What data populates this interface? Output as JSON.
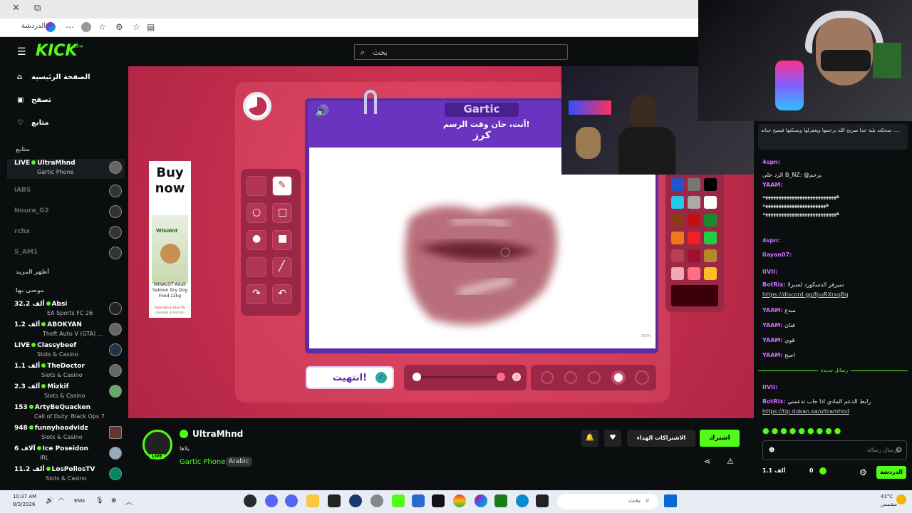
{
  "browser": {
    "sidebar_label": "الدردشة",
    "win_close": "✕",
    "win_restore": "⧉"
  },
  "kick": {
    "logo": "KICK",
    "logo_beta": "BETA",
    "search_placeholder": "بحث",
    "nav": [
      {
        "label": "الصفحة الرئيسية",
        "icon": "home-icon"
      },
      {
        "label": "تصفح",
        "icon": "browse-icon"
      },
      {
        "label": "متابع",
        "icon": "heart-icon"
      }
    ],
    "following_title": "متابع",
    "show_more": "أظهر المزيد",
    "recommended_title": "موصى بها",
    "following": [
      {
        "name": "UltraMhnd",
        "status": "LIVE",
        "game": "Gartic Phone",
        "live": true
      },
      {
        "name": "iABS",
        "live": false
      },
      {
        "name": "Noura_G2",
        "live": false
      },
      {
        "name": "rchx",
        "live": false
      },
      {
        "name": "S_AM1",
        "live": false
      }
    ],
    "recommended": [
      {
        "count": "32.2 ألف",
        "name": "Absi",
        "game": "EA Sports FC 26"
      },
      {
        "count": "1.2 ألف",
        "name": "ABOKYAN",
        "game": "Theft Auto V (GTA) ..."
      },
      {
        "count": "LIVE",
        "name": "Classybeef",
        "game": "Slots & Casino"
      },
      {
        "count": "1.1 ألف",
        "name": "TheDoctor",
        "game": "Slots & Casino"
      },
      {
        "count": "2.3 ألف",
        "name": "Mizkif",
        "game": "Slots & Casino"
      },
      {
        "count": "153",
        "name": "ArtyBeQuacken",
        "game": "Call of Duty: Black Ops 7"
      },
      {
        "count": "948",
        "name": "funnyhoodvidz",
        "game": "Slots & Casino"
      },
      {
        "count": "6 آلاف",
        "name": "Ice Poseidon",
        "game": "IRL"
      },
      {
        "count": "11.2 ألف",
        "name": "LosPollosTV",
        "game": "Slots & Casino"
      }
    ]
  },
  "game": {
    "brand": "Gartic",
    "prompt": "أنت، حان وقت الرسم!",
    "word": "كرز",
    "done_button": "انتهيت!",
    "zoom": "300%",
    "colors": [
      "#2255cc",
      "#777777",
      "#000000",
      "#22c8f0",
      "#aaaaaa",
      "#ffffff",
      "#8b3a1a",
      "#c01010",
      "#1a8a2a",
      "#f07818",
      "#ee2222",
      "#22cc44",
      "#b84050",
      "#a01030",
      "#b8862a",
      "#f4a8b0",
      "#ff7080",
      "#f8c020"
    ],
    "selected_color": "#3a0008",
    "brush_size_fraction": 0.82
  },
  "ad": {
    "headline": "Buy now",
    "product": "WINALOT Adult Salmon Dry Dog Food 12kg",
    "brand": "Winalot",
    "cta": "Subscribe & Save 5%",
    "source": "Available at Amazon"
  },
  "stream": {
    "streamer": "UltraMhnd",
    "live_badge": "LIVE",
    "subtitle": "يلاها",
    "category": "Gartic Phone",
    "language": "Arabic",
    "subscribe": "اشترك",
    "gift_subs": "الاشتراكات الهداء"
  },
  "chat": {
    "pinned": "صحكته بلية جدا صريح الله يرحمها ويغفرلها ويسكنها فسيح جناته ....",
    "messages": [
      {
        "user": "4spn:",
        "text": ""
      },
      {
        "user": "",
        "text": "الرد على B_NZ: @يرحم"
      },
      {
        "user": "YAAM:",
        "text": ""
      },
      {
        "user": "",
        "text": "ههههههههههههههههههههههههههههه"
      },
      {
        "user": "",
        "text": "ههههههههههههههههههههههههه"
      },
      {
        "user": "",
        "text": "ههههههههههههههههههههههههههههه"
      },
      {
        "user": "4spn:",
        "text": ""
      },
      {
        "user": "ilayan07:",
        "text": ""
      },
      {
        "user": "IIVII:",
        "text": ""
      },
      {
        "user": "BotRix:",
        "text": "سيرفر الدسكورد لسبرلا"
      },
      {
        "user": "",
        "text": "https://discord.gg/fpuRXrxqBq",
        "link": true
      },
      {
        "user": "YAAM:",
        "text": "مبدع"
      },
      {
        "user": "YAAM:",
        "text": "فنان"
      },
      {
        "user": "YAAM:",
        "text": "قوي"
      },
      {
        "user": "YAAM:",
        "text": "احبح"
      },
      {
        "user": "IIVII:",
        "text": ""
      },
      {
        "user": "BotRix:",
        "text": "رابط الدعم المادي اذا حاب تدعمني"
      },
      {
        "user": "",
        "text": "https://tip.dokan.sa/ultramhnd",
        "link": true
      }
    ],
    "new_messages": "رسائل جديدة",
    "input_placeholder": "إرسال رسالة",
    "send_button": "الدردشة",
    "viewers": "1.1 ألف",
    "points": "0"
  },
  "taskbar": {
    "time": "10:37 AM",
    "date": "8/3/2026",
    "lang": "ENG",
    "search": "بحث",
    "temp": "41°C",
    "weather": "مشمس"
  }
}
